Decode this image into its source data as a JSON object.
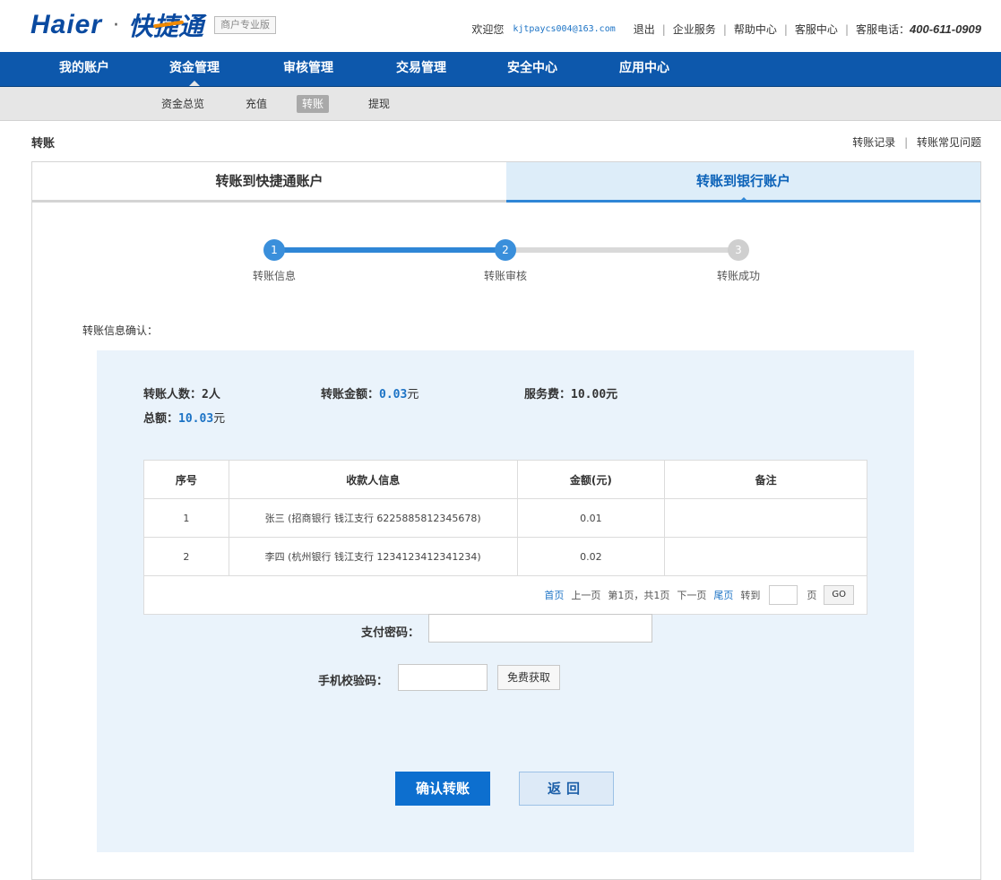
{
  "header": {
    "logo_en": "Haier",
    "logo_dot": "·",
    "logo_cn": "快捷通",
    "edition": "商户专业版",
    "welcome": "欢迎您",
    "email": "kjtpaycs004@163.com",
    "links": [
      "退出",
      "企业服务",
      "帮助中心",
      "客服中心"
    ],
    "phone_label": "客服电话：",
    "phone": "400-611-0909"
  },
  "mainnav": [
    "我的账户",
    "资金管理",
    "审核管理",
    "交易管理",
    "安全中心",
    "应用中心"
  ],
  "subnav": [
    "资金总览",
    "充值",
    "转账",
    "提现"
  ],
  "page": {
    "title": "转账",
    "link_records": "转账记录",
    "link_faq": "转账常见问题"
  },
  "tabs": {
    "left": "转账到快捷通账户",
    "right": "转账到银行账户"
  },
  "steps": [
    {
      "num": "1",
      "label": "转账信息"
    },
    {
      "num": "2",
      "label": "转账审核"
    },
    {
      "num": "3",
      "label": "转账成功"
    }
  ],
  "confirm_label": "转账信息确认：",
  "summary": {
    "count_label": "转账人数：",
    "count_value": "2人",
    "amount_label": "转账金额：",
    "amount_value": "0.03",
    "amount_unit": "元",
    "fee_label": "服务费：",
    "fee_value": "10.00元",
    "total_label": "总额：",
    "total_value": "10.03",
    "total_unit": "元"
  },
  "table": {
    "headers": [
      "序号",
      "收款人信息",
      "金额(元)",
      "备注"
    ],
    "rows": [
      {
        "no": "1",
        "payee": "张三 (招商银行 钱江支行 6225885812345678)",
        "amount": "0.01",
        "note": ""
      },
      {
        "no": "2",
        "payee": "李四 (杭州银行 钱江支行 1234123412341234)",
        "amount": "0.02",
        "note": ""
      }
    ]
  },
  "pager": {
    "first": "首页",
    "prev": "上一页",
    "info": "第1页，共1页",
    "next": "下一页",
    "last": "尾页",
    "goto": "转到",
    "page_unit": "页",
    "go": "GO"
  },
  "form": {
    "pay_password_label": "支付密码：",
    "sms_label": "手机校验码：",
    "get_code": "免费获取"
  },
  "buttons": {
    "confirm": "确认转账",
    "back": "返回"
  }
}
